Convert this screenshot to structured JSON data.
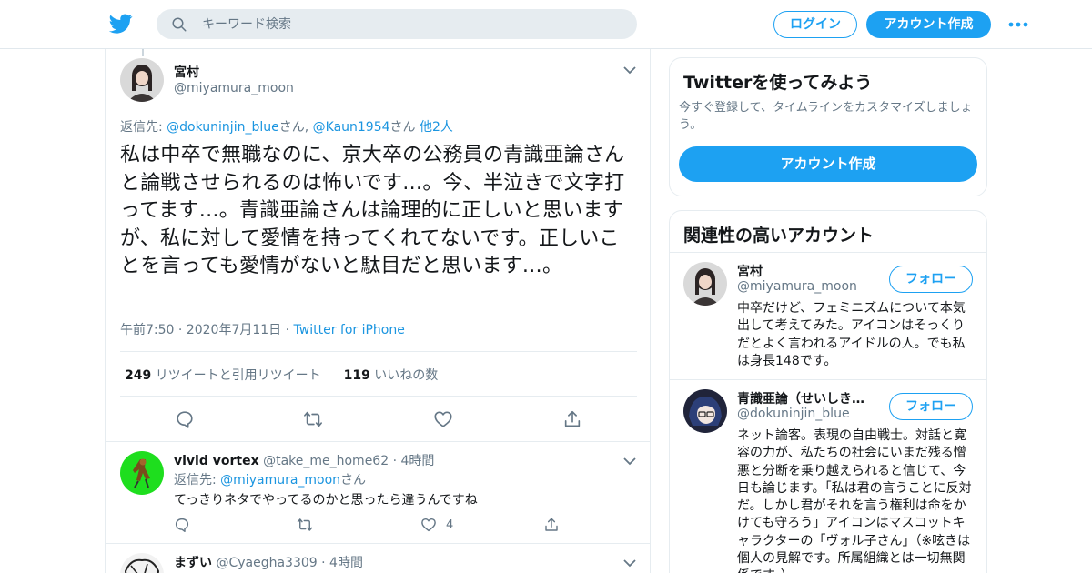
{
  "colors": {
    "accent": "#1da1f2",
    "link": "#1b95e0",
    "muted": "#657786",
    "border": "#e6ecf0"
  },
  "header": {
    "search_placeholder": "キーワード検索",
    "login_label": "ログイン",
    "signup_label": "アカウント作成"
  },
  "tweet": {
    "name": "宮村",
    "handle": "@miyamura_moon",
    "reply_prefix": "返信先: ",
    "reply_user1": "@dokuninjin_blue",
    "reply_san1": "さん, ",
    "reply_user2": "@Kaun1954",
    "reply_san2": "さん ",
    "reply_others": "他2人",
    "text": "私は中卒で無職なのに、京大卒の公務員の青識亜論さんと論戦させられるのは怖いです…。今、半泣きで文字打ってます…。青識亜論さんは論理的に正しいと思いますが、私に対して愛情を持ってくれてないです。正しいことを言っても愛情がないと駄目だと思います…。",
    "time": "午前7:50",
    "date": "2020年7月11日",
    "source": "Twitter for iPhone",
    "retweet_count": "249",
    "retweet_label": "リツイートと引用リツイート",
    "like_count": "119",
    "like_label": "いいねの数"
  },
  "replies": [
    {
      "name": "vivid vortex",
      "handle": "@take_me_home62",
      "time": "4時間",
      "reply_prefix": "返信先: ",
      "reply_user": "@miyamura_moon",
      "reply_suffix": "さん",
      "text": "てっきりネタでやってるのかと思ったら違うんですね",
      "like_count": "4"
    },
    {
      "name": "まずい",
      "handle": "@Cyaegha3309",
      "time": "4時間"
    }
  ],
  "sidebar": {
    "signup_card": {
      "title": "Twitterを使ってみよう",
      "desc": "今すぐ登録して、タイムラインをカスタマイズしましょう。",
      "cta": "アカウント作成"
    },
    "related": {
      "title": "関連性の高いアカウント",
      "follow_label": "フォロー",
      "accounts": [
        {
          "name": "宮村",
          "handle": "@miyamura_moon",
          "bio": "中卒だけど、フェミニズムについて本気出して考えてみた。アイコンはそっくりだとよく言われるアイドルの人。でも私は身長148です。"
        },
        {
          "name": "青識亜論（せいしき…",
          "handle": "@dokuninjin_blue",
          "bio": "ネット論客。表現の自由戦士。対話と寛容の力が、私たちの社会にいまだ残る憎悪と分断を乗り越えられると信じて、今日も論じます。「私は君の言うことに反対だ。しかし君がそれを言う権利は命をかけても守ろう」アイコンはマスコットキャラクターの「ヴォル子さん」（※呟きは個人の見解です。所属組織とは一切無関係です。）"
        }
      ]
    }
  }
}
